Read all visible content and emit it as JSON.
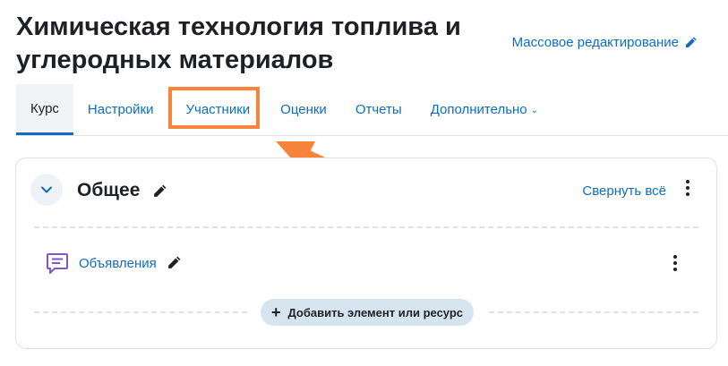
{
  "header": {
    "course_title": "Химическая технология топлива и углеродных материалов",
    "bulk_edit_label": "Массовое редактирование"
  },
  "tabs": [
    {
      "label": "Курс",
      "active": true
    },
    {
      "label": "Настройки",
      "active": false
    },
    {
      "label": "Участники",
      "active": false
    },
    {
      "label": "Оценки",
      "active": false
    },
    {
      "label": "Отчеты",
      "active": false
    },
    {
      "label": "Дополнительно",
      "active": false
    }
  ],
  "section": {
    "title": "Общее",
    "collapse_all_label": "Свернуть всё",
    "activity": {
      "name": "Объявления",
      "icon": "forum-icon"
    },
    "add_label": "Добавить элемент или ресурс"
  },
  "annotation": {
    "highlight_color": "#f7843a",
    "highlighted_tab": "Участники"
  },
  "colors": {
    "link": "#0f6cbf",
    "text": "#1d2125",
    "forum_icon": "#7f57d1"
  }
}
